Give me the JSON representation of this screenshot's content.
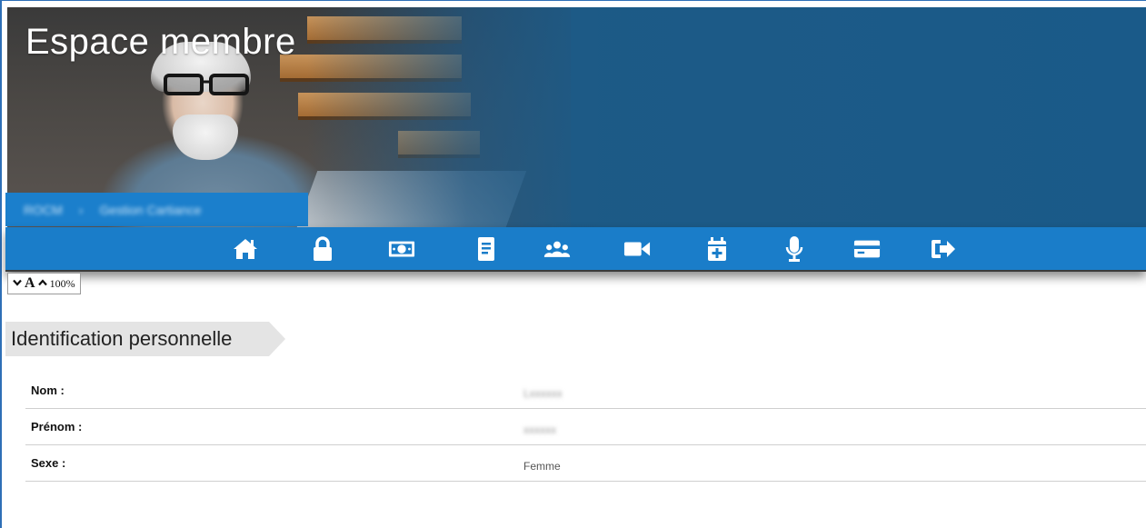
{
  "header": {
    "title": "Espace membre"
  },
  "breadcrumb": {
    "items": [
      "ROCM",
      "Gestion Cartiance"
    ]
  },
  "nav": {
    "items": [
      {
        "name": "home-icon",
        "icon": "home"
      },
      {
        "name": "lock-icon",
        "icon": "lock"
      },
      {
        "name": "money-icon",
        "icon": "money"
      },
      {
        "name": "document-icon",
        "icon": "document"
      },
      {
        "name": "group-icon",
        "icon": "group"
      },
      {
        "name": "video-icon",
        "icon": "video"
      },
      {
        "name": "calendar-plus-icon",
        "icon": "calendar-plus"
      },
      {
        "name": "microphone-icon",
        "icon": "microphone"
      },
      {
        "name": "credit-card-icon",
        "icon": "credit-card"
      },
      {
        "name": "logout-icon",
        "icon": "logout"
      }
    ],
    "color": "#1a7dc9"
  },
  "font_control": {
    "decrease": "⌄",
    "letter": "A",
    "increase": "⌃",
    "zoom": "100%"
  },
  "section": {
    "title": "Identification personnelle"
  },
  "fields": [
    {
      "label": "Nom :",
      "value": "Lxxxxxx"
    },
    {
      "label": "Prénom :",
      "value": "xxxxxx"
    },
    {
      "label": "Sexe :",
      "value": "Femme"
    }
  ]
}
